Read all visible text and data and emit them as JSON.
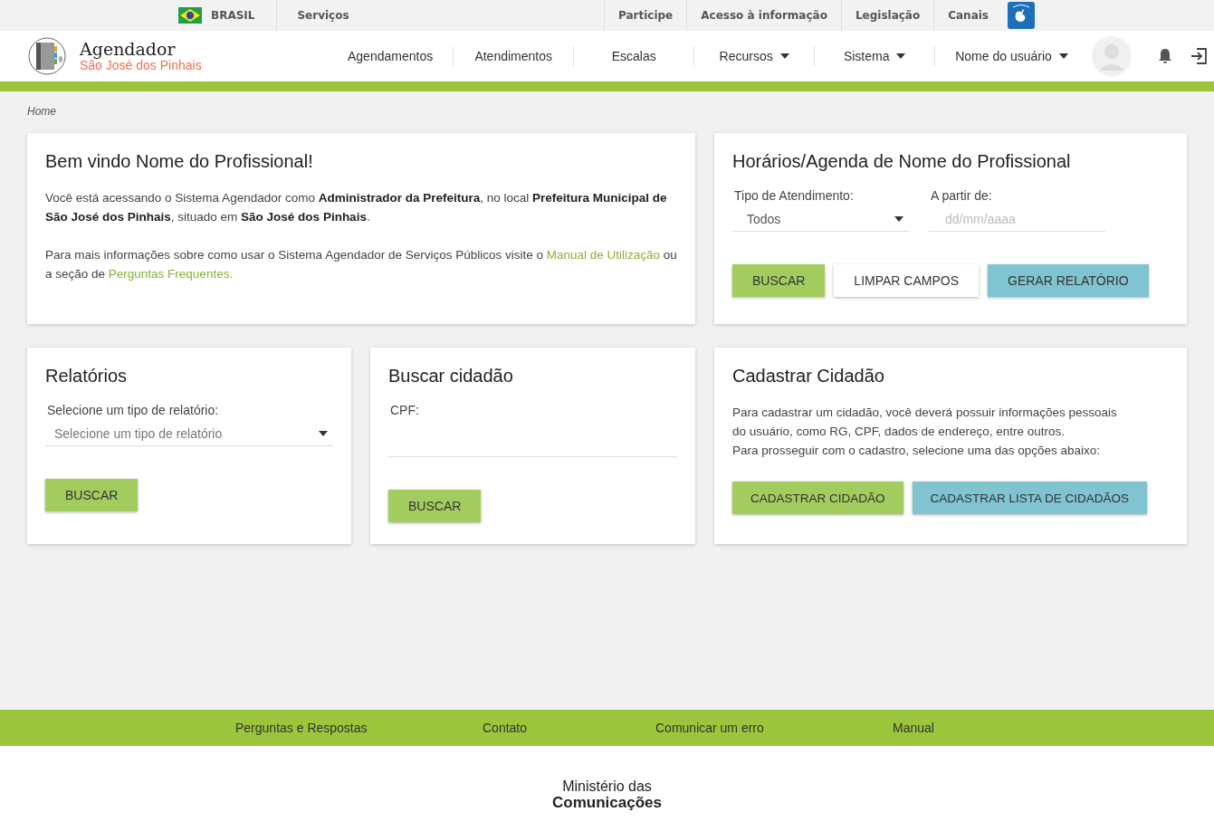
{
  "gov_bar": {
    "country": "BRASIL",
    "links": [
      "Serviços"
    ],
    "right_links": [
      "Participe",
      "Acesso à informação",
      "Legislação",
      "Canais"
    ]
  },
  "header": {
    "app_name": "Agendador",
    "city": "São José dos Pinhais",
    "nav": [
      {
        "label": "Agendamentos",
        "dropdown": false
      },
      {
        "label": "Atendimentos",
        "dropdown": false
      },
      {
        "label": "Escalas",
        "dropdown": false
      },
      {
        "label": "Recursos",
        "dropdown": true
      },
      {
        "label": "Sistema",
        "dropdown": true
      }
    ],
    "user": "Nome do usuário"
  },
  "breadcrumb": "Home",
  "welcome": {
    "title": "Bem vindo Nome do Profissional!",
    "intro": "Você está acessando o Sistema Agendador como **Administrador da Prefeitura**, no local **Prefeitura Municipal de São José dos Pinhais**, situado em **São José dos Pinhais**.",
    "help": [
      {
        "kind": "text",
        "text": "Para mais informações sobre como usar o Sistema Agendador de Serviços Públicos visite o "
      },
      {
        "kind": "link",
        "text": "Manual de Utilização"
      },
      {
        "kind": "text",
        "text": " ou a seção de "
      },
      {
        "kind": "link",
        "text": "Perguntas Frequentes."
      }
    ]
  },
  "schedule": {
    "title": "Horários/Agenda de Nome do Profissional",
    "type_label": "Tipo de Atendimento:",
    "type_value": "Todos",
    "date_label": "A partir de:",
    "date_placeholder": "dd/mm/aaaa",
    "buttons": [
      {
        "label": "BUSCAR",
        "kind": "primary"
      },
      {
        "label": "LIMPAR CAMPOS",
        "kind": "plain"
      },
      {
        "label": "GERAR RELATÓRIO",
        "kind": "secondary"
      }
    ]
  },
  "reports": {
    "title": "Relatórios",
    "label": "Selecione um tipo de relatório:",
    "placeholder": "Selecione um tipo de relatório",
    "buttons": [
      {
        "label": "BUSCAR",
        "kind": "primary"
      }
    ]
  },
  "search_citizen": {
    "title": "Buscar cidadão",
    "label": "CPF:",
    "buttons": [
      {
        "label": "BUSCAR",
        "kind": "primary"
      }
    ]
  },
  "register": {
    "title": "Cadastrar Cidadão",
    "lines": [
      "Para cadastrar um cidadão, você deverá possuir informações pessoais",
      "do usuário, como RG, CPF, dados de endereço, entre outros.",
      "Para prosseguir com o cadastro, selecione uma das opções abaixo:"
    ],
    "buttons": [
      {
        "label": "CADASTRAR CIDADÃO",
        "kind": "primary"
      },
      {
        "label": "CADASTRAR LISTA DE CIDADÃOS",
        "kind": "secondary"
      }
    ]
  },
  "footer": {
    "links": [
      "Perguntas e Respostas",
      "Contato",
      "Comunicar um erro",
      "Manual"
    ],
    "logo_lines": [
      "Ministério das",
      "Comunicações"
    ]
  }
}
